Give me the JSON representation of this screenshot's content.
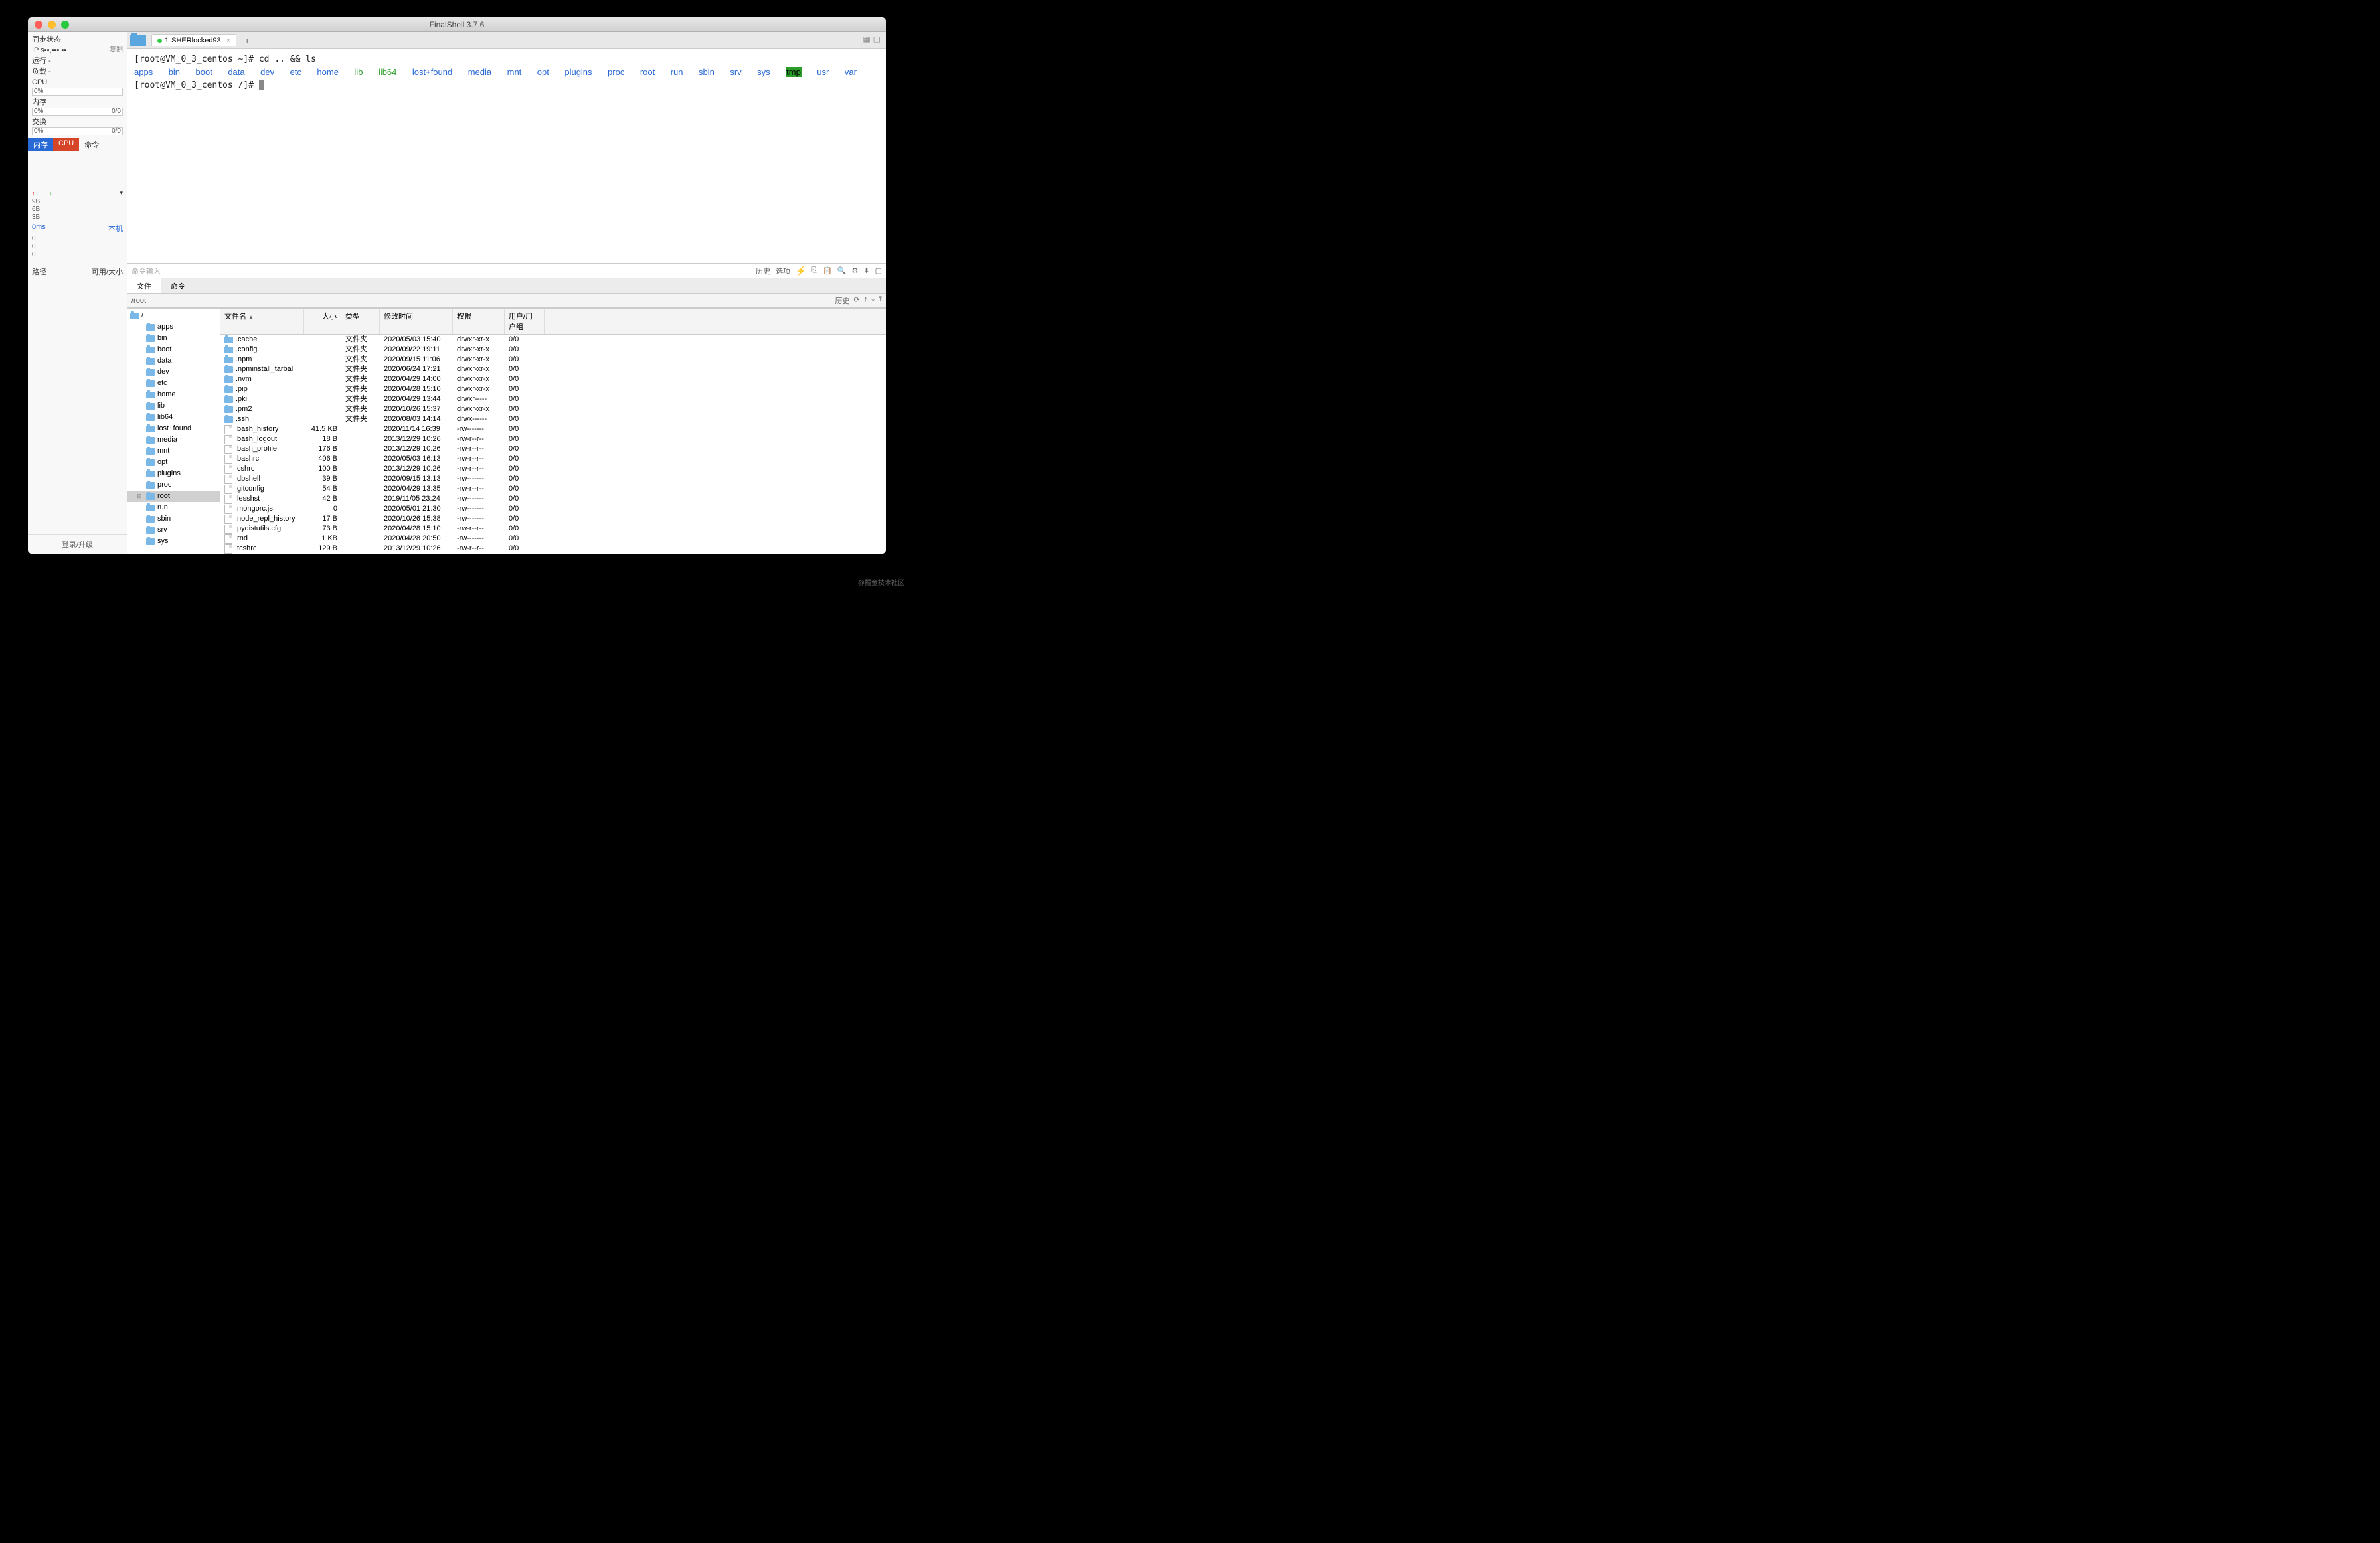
{
  "title": "FinalShell 3.7.6",
  "sidebar": {
    "sync_label": "同步状态",
    "ip_label": "IP s▪▪,▪▪▪ ▪▪",
    "copy": "复制",
    "run_label": "运行 -",
    "load_label": "负载 -",
    "cpu_label": "CPU",
    "cpu_val": "0%",
    "mem_label": "内存",
    "mem_val": "0%",
    "mem_rt": "0/0",
    "swap_label": "交换",
    "swap_val": "0%",
    "swap_rt": "0/0",
    "tab_mem": "内存",
    "tab_cpu": "CPU",
    "tab_cmd": "命令",
    "ticks": [
      "9B",
      "6B",
      "3B"
    ],
    "ms": "0ms",
    "host": "本机",
    "zeros": [
      "0",
      "0",
      "0"
    ],
    "path_label": "路径",
    "avail_label": "可用/大小",
    "login": "登录/升级"
  },
  "tab": {
    "index": "1",
    "name": "SHERlocked93"
  },
  "terminal": {
    "prompt1": "[root@VM_0_3_centos ~]# ",
    "cmd1": "cd .. && ls",
    "dirs": [
      {
        "t": "apps",
        "c": "b"
      },
      {
        "t": "bin",
        "c": "b"
      },
      {
        "t": "boot",
        "c": "b"
      },
      {
        "t": "data",
        "c": "b"
      },
      {
        "t": "dev",
        "c": "b"
      },
      {
        "t": "etc",
        "c": "b"
      },
      {
        "t": "home",
        "c": "b"
      },
      {
        "t": "lib",
        "c": "g"
      },
      {
        "t": "lib64",
        "c": "g"
      },
      {
        "t": "lost+found",
        "c": "b"
      },
      {
        "t": "media",
        "c": "b"
      },
      {
        "t": "mnt",
        "c": "b"
      },
      {
        "t": "opt",
        "c": "b"
      },
      {
        "t": "plugins",
        "c": "b"
      },
      {
        "t": "proc",
        "c": "b"
      },
      {
        "t": "root",
        "c": "b"
      },
      {
        "t": "run",
        "c": "b"
      },
      {
        "t": "sbin",
        "c": "b"
      },
      {
        "t": "srv",
        "c": "b"
      },
      {
        "t": "sys",
        "c": "b"
      },
      {
        "t": "tmp",
        "c": "hl"
      },
      {
        "t": "usr",
        "c": "b"
      },
      {
        "t": "var",
        "c": "b"
      }
    ],
    "prompt2": "[root@VM_0_3_centos /]# "
  },
  "cmdinput": {
    "placeholder": "命令输入",
    "history": "历史",
    "options": "选项"
  },
  "bottom_tabs": {
    "file": "文件",
    "cmd": "命令"
  },
  "pathbar": {
    "path": "/root",
    "history": "历史"
  },
  "tree": [
    {
      "name": "/",
      "root": true
    },
    {
      "name": "apps"
    },
    {
      "name": "bin"
    },
    {
      "name": "boot"
    },
    {
      "name": "data"
    },
    {
      "name": "dev"
    },
    {
      "name": "etc"
    },
    {
      "name": "home"
    },
    {
      "name": "lib"
    },
    {
      "name": "lib64"
    },
    {
      "name": "lost+found"
    },
    {
      "name": "media"
    },
    {
      "name": "mnt"
    },
    {
      "name": "opt"
    },
    {
      "name": "plugins"
    },
    {
      "name": "proc"
    },
    {
      "name": "root",
      "sel": true,
      "expand": true
    },
    {
      "name": "run"
    },
    {
      "name": "sbin"
    },
    {
      "name": "srv"
    },
    {
      "name": "sys"
    }
  ],
  "filelist": {
    "headers": {
      "name": "文件名",
      "size": "大小",
      "type": "类型",
      "date": "修改时间",
      "perm": "权限",
      "user": "用户/用户组"
    },
    "rows": [
      {
        "name": ".cache",
        "size": "",
        "type": "文件夹",
        "date": "2020/05/03 15:40",
        "perm": "drwxr-xr-x",
        "user": "0/0",
        "dir": true
      },
      {
        "name": ".config",
        "size": "",
        "type": "文件夹",
        "date": "2020/09/22 19:11",
        "perm": "drwxr-xr-x",
        "user": "0/0",
        "dir": true
      },
      {
        "name": ".npm",
        "size": "",
        "type": "文件夹",
        "date": "2020/09/15 11:06",
        "perm": "drwxr-xr-x",
        "user": "0/0",
        "dir": true
      },
      {
        "name": ".npminstall_tarball",
        "size": "",
        "type": "文件夹",
        "date": "2020/06/24 17:21",
        "perm": "drwxr-xr-x",
        "user": "0/0",
        "dir": true
      },
      {
        "name": ".nvm",
        "size": "",
        "type": "文件夹",
        "date": "2020/04/29 14:00",
        "perm": "drwxr-xr-x",
        "user": "0/0",
        "dir": true
      },
      {
        "name": ".pip",
        "size": "",
        "type": "文件夹",
        "date": "2020/04/28 15:10",
        "perm": "drwxr-xr-x",
        "user": "0/0",
        "dir": true
      },
      {
        "name": ".pki",
        "size": "",
        "type": "文件夹",
        "date": "2020/04/29 13:44",
        "perm": "drwxr-----",
        "user": "0/0",
        "dir": true
      },
      {
        "name": ".pm2",
        "size": "",
        "type": "文件夹",
        "date": "2020/10/26 15:37",
        "perm": "drwxr-xr-x",
        "user": "0/0",
        "dir": true
      },
      {
        "name": ".ssh",
        "size": "",
        "type": "文件夹",
        "date": "2020/08/03 14:14",
        "perm": "drwx------",
        "user": "0/0",
        "dir": true
      },
      {
        "name": ".bash_history",
        "size": "41.5 KB",
        "type": "",
        "date": "2020/11/14 16:39",
        "perm": "-rw-------",
        "user": "0/0"
      },
      {
        "name": ".bash_logout",
        "size": "18 B",
        "type": "",
        "date": "2013/12/29 10:26",
        "perm": "-rw-r--r--",
        "user": "0/0"
      },
      {
        "name": ".bash_profile",
        "size": "176 B",
        "type": "",
        "date": "2013/12/29 10:26",
        "perm": "-rw-r--r--",
        "user": "0/0"
      },
      {
        "name": ".bashrc",
        "size": "406 B",
        "type": "",
        "date": "2020/05/03 16:13",
        "perm": "-rw-r--r--",
        "user": "0/0"
      },
      {
        "name": ".cshrc",
        "size": "100 B",
        "type": "",
        "date": "2013/12/29 10:26",
        "perm": "-rw-r--r--",
        "user": "0/0"
      },
      {
        "name": ".dbshell",
        "size": "39 B",
        "type": "",
        "date": "2020/09/15 13:13",
        "perm": "-rw-------",
        "user": "0/0"
      },
      {
        "name": ".gitconfig",
        "size": "54 B",
        "type": "",
        "date": "2020/04/29 13:35",
        "perm": "-rw-r--r--",
        "user": "0/0"
      },
      {
        "name": ".lesshst",
        "size": "42 B",
        "type": "",
        "date": "2019/11/05 23:24",
        "perm": "-rw-------",
        "user": "0/0"
      },
      {
        "name": ".mongorc.js",
        "size": "0",
        "type": "",
        "date": "2020/05/01 21:30",
        "perm": "-rw-------",
        "user": "0/0",
        "js": true
      },
      {
        "name": ".node_repl_history",
        "size": "17 B",
        "type": "",
        "date": "2020/10/26 15:38",
        "perm": "-rw-------",
        "user": "0/0"
      },
      {
        "name": ".pydistutils.cfg",
        "size": "73 B",
        "type": "",
        "date": "2020/04/28 15:10",
        "perm": "-rw-r--r--",
        "user": "0/0"
      },
      {
        "name": ".rnd",
        "size": "1 KB",
        "type": "",
        "date": "2020/04/28 20:50",
        "perm": "-rw-------",
        "user": "0/0"
      },
      {
        "name": ".tcshrc",
        "size": "129 B",
        "type": "",
        "date": "2013/12/29 10:26",
        "perm": "-rw-r--r--",
        "user": "0/0"
      }
    ]
  },
  "watermark": "@掘金技术社区"
}
